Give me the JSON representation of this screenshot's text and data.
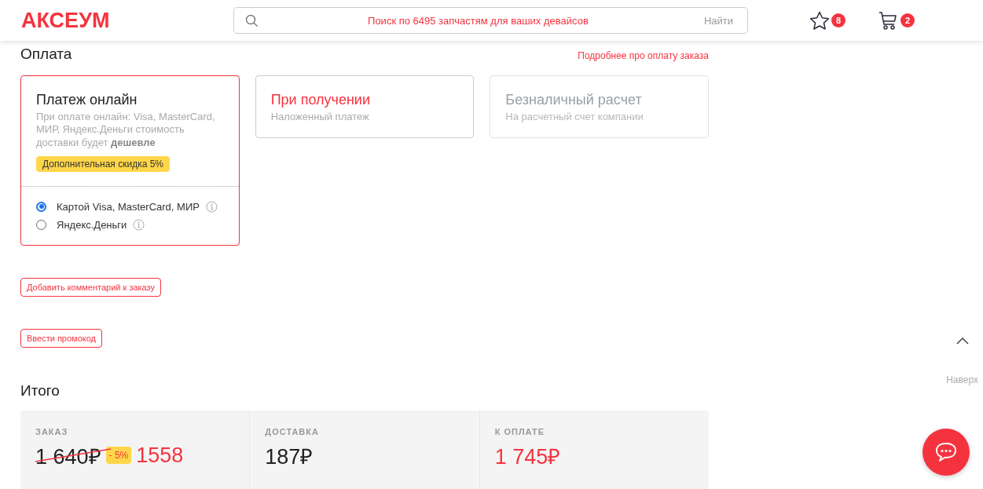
{
  "header": {
    "logo": "АКСЕУМ",
    "search": {
      "placeholder": "Поиск по 6495 запчастям для ваших девайсов",
      "button": "Найти"
    },
    "favorites_count": "8",
    "cart_count": "2"
  },
  "payment": {
    "title": "Оплата",
    "info_link": "Подробнее про оплату заказа",
    "methods": [
      {
        "title": "Платеж онлайн",
        "subtitle": "При оплате онлайн: Visa, MasterCard, МИР, Яндекс.Деньги стоимость доставки будет **дешевле**",
        "badge": "Дополнительная скидка 5%",
        "selected": true,
        "hovered": false,
        "disabled": false,
        "options": [
          {
            "label": "Картой Visa, MasterCard, МИР",
            "selected": true
          },
          {
            "label": "Яндекс.Деньги",
            "selected": false
          }
        ]
      },
      {
        "title": "При получении",
        "subtitle": "Наложенный платеж",
        "selected": false,
        "hovered": true,
        "disabled": false
      },
      {
        "title": "Безналичный расчет",
        "subtitle": "На расчетный счет компании",
        "selected": false,
        "hovered": false,
        "disabled": true
      }
    ]
  },
  "comment_button": "Добавить комментарий к заказу",
  "promo_button": "Ввести промокод",
  "summary": {
    "title": "Итого",
    "columns": [
      {
        "label": "ЗАКАЗ",
        "old_price": "1 640₽",
        "discount": "- 5%",
        "value": "1558",
        "accent": true
      },
      {
        "label": "ДОСТАВКА",
        "value": "187₽",
        "accent": false
      },
      {
        "label": "К ОПЛАТЕ",
        "value": "1 745₽",
        "accent": true
      }
    ]
  },
  "to_top": "Наверх"
}
